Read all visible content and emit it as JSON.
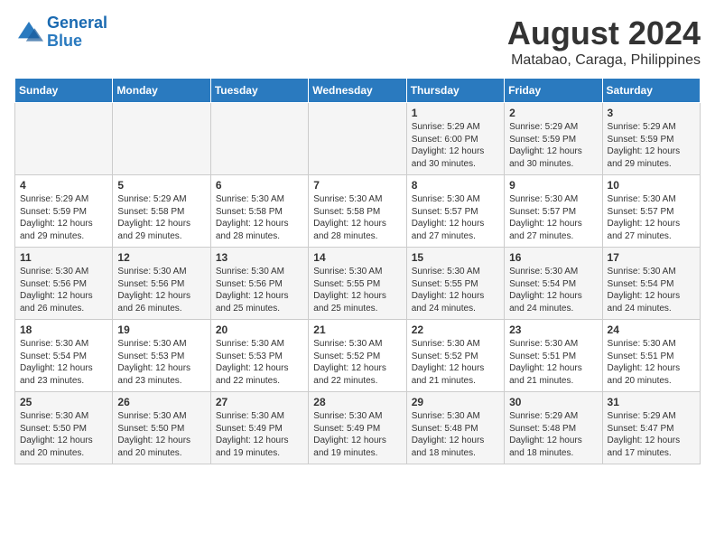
{
  "header": {
    "logo_line1": "General",
    "logo_line2": "Blue",
    "month_year": "August 2024",
    "location": "Matabao, Caraga, Philippines"
  },
  "days_of_week": [
    "Sunday",
    "Monday",
    "Tuesday",
    "Wednesday",
    "Thursday",
    "Friday",
    "Saturday"
  ],
  "weeks": [
    [
      {
        "day": "",
        "content": ""
      },
      {
        "day": "",
        "content": ""
      },
      {
        "day": "",
        "content": ""
      },
      {
        "day": "",
        "content": ""
      },
      {
        "day": "1",
        "content": "Sunrise: 5:29 AM\nSunset: 6:00 PM\nDaylight: 12 hours\nand 30 minutes."
      },
      {
        "day": "2",
        "content": "Sunrise: 5:29 AM\nSunset: 5:59 PM\nDaylight: 12 hours\nand 30 minutes."
      },
      {
        "day": "3",
        "content": "Sunrise: 5:29 AM\nSunset: 5:59 PM\nDaylight: 12 hours\nand 29 minutes."
      }
    ],
    [
      {
        "day": "4",
        "content": "Sunrise: 5:29 AM\nSunset: 5:59 PM\nDaylight: 12 hours\nand 29 minutes."
      },
      {
        "day": "5",
        "content": "Sunrise: 5:29 AM\nSunset: 5:58 PM\nDaylight: 12 hours\nand 29 minutes."
      },
      {
        "day": "6",
        "content": "Sunrise: 5:30 AM\nSunset: 5:58 PM\nDaylight: 12 hours\nand 28 minutes."
      },
      {
        "day": "7",
        "content": "Sunrise: 5:30 AM\nSunset: 5:58 PM\nDaylight: 12 hours\nand 28 minutes."
      },
      {
        "day": "8",
        "content": "Sunrise: 5:30 AM\nSunset: 5:57 PM\nDaylight: 12 hours\nand 27 minutes."
      },
      {
        "day": "9",
        "content": "Sunrise: 5:30 AM\nSunset: 5:57 PM\nDaylight: 12 hours\nand 27 minutes."
      },
      {
        "day": "10",
        "content": "Sunrise: 5:30 AM\nSunset: 5:57 PM\nDaylight: 12 hours\nand 27 minutes."
      }
    ],
    [
      {
        "day": "11",
        "content": "Sunrise: 5:30 AM\nSunset: 5:56 PM\nDaylight: 12 hours\nand 26 minutes."
      },
      {
        "day": "12",
        "content": "Sunrise: 5:30 AM\nSunset: 5:56 PM\nDaylight: 12 hours\nand 26 minutes."
      },
      {
        "day": "13",
        "content": "Sunrise: 5:30 AM\nSunset: 5:56 PM\nDaylight: 12 hours\nand 25 minutes."
      },
      {
        "day": "14",
        "content": "Sunrise: 5:30 AM\nSunset: 5:55 PM\nDaylight: 12 hours\nand 25 minutes."
      },
      {
        "day": "15",
        "content": "Sunrise: 5:30 AM\nSunset: 5:55 PM\nDaylight: 12 hours\nand 24 minutes."
      },
      {
        "day": "16",
        "content": "Sunrise: 5:30 AM\nSunset: 5:54 PM\nDaylight: 12 hours\nand 24 minutes."
      },
      {
        "day": "17",
        "content": "Sunrise: 5:30 AM\nSunset: 5:54 PM\nDaylight: 12 hours\nand 24 minutes."
      }
    ],
    [
      {
        "day": "18",
        "content": "Sunrise: 5:30 AM\nSunset: 5:54 PM\nDaylight: 12 hours\nand 23 minutes."
      },
      {
        "day": "19",
        "content": "Sunrise: 5:30 AM\nSunset: 5:53 PM\nDaylight: 12 hours\nand 23 minutes."
      },
      {
        "day": "20",
        "content": "Sunrise: 5:30 AM\nSunset: 5:53 PM\nDaylight: 12 hours\nand 22 minutes."
      },
      {
        "day": "21",
        "content": "Sunrise: 5:30 AM\nSunset: 5:52 PM\nDaylight: 12 hours\nand 22 minutes."
      },
      {
        "day": "22",
        "content": "Sunrise: 5:30 AM\nSunset: 5:52 PM\nDaylight: 12 hours\nand 21 minutes."
      },
      {
        "day": "23",
        "content": "Sunrise: 5:30 AM\nSunset: 5:51 PM\nDaylight: 12 hours\nand 21 minutes."
      },
      {
        "day": "24",
        "content": "Sunrise: 5:30 AM\nSunset: 5:51 PM\nDaylight: 12 hours\nand 20 minutes."
      }
    ],
    [
      {
        "day": "25",
        "content": "Sunrise: 5:30 AM\nSunset: 5:50 PM\nDaylight: 12 hours\nand 20 minutes."
      },
      {
        "day": "26",
        "content": "Sunrise: 5:30 AM\nSunset: 5:50 PM\nDaylight: 12 hours\nand 20 minutes."
      },
      {
        "day": "27",
        "content": "Sunrise: 5:30 AM\nSunset: 5:49 PM\nDaylight: 12 hours\nand 19 minutes."
      },
      {
        "day": "28",
        "content": "Sunrise: 5:30 AM\nSunset: 5:49 PM\nDaylight: 12 hours\nand 19 minutes."
      },
      {
        "day": "29",
        "content": "Sunrise: 5:30 AM\nSunset: 5:48 PM\nDaylight: 12 hours\nand 18 minutes."
      },
      {
        "day": "30",
        "content": "Sunrise: 5:29 AM\nSunset: 5:48 PM\nDaylight: 12 hours\nand 18 minutes."
      },
      {
        "day": "31",
        "content": "Sunrise: 5:29 AM\nSunset: 5:47 PM\nDaylight: 12 hours\nand 17 minutes."
      }
    ]
  ]
}
